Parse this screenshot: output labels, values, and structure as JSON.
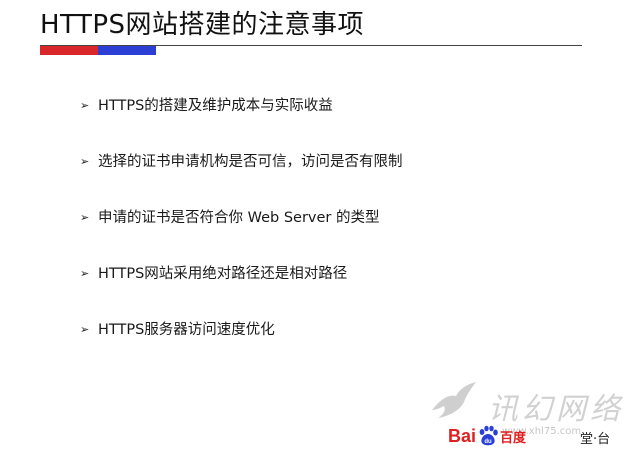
{
  "slide": {
    "title": "HTTPS网站搭建的注意事项",
    "bullet_symbol": "➢",
    "bullets": [
      "HTTPS的搭建及维护成本与实际收益",
      "选择的证书申请机构是否可信，访问是否有限制",
      "申请的证书是否符合你 Web Server 的类型",
      "HTTPS网站采用绝对路径还是相对路径",
      "HTTPS服务器访问速度优化"
    ]
  },
  "watermark": {
    "brand": "讯幻网络",
    "url": "www.xhl75.com",
    "baidu_left": "Bai",
    "baidu_right": "百度",
    "platform": "堂·台",
    "colors": {
      "baidu_red": "#e02020",
      "baidu_blue": "#2a3fd6"
    }
  },
  "colors": {
    "accent_red": "#d9262a",
    "accent_blue": "#2b3fd4"
  }
}
